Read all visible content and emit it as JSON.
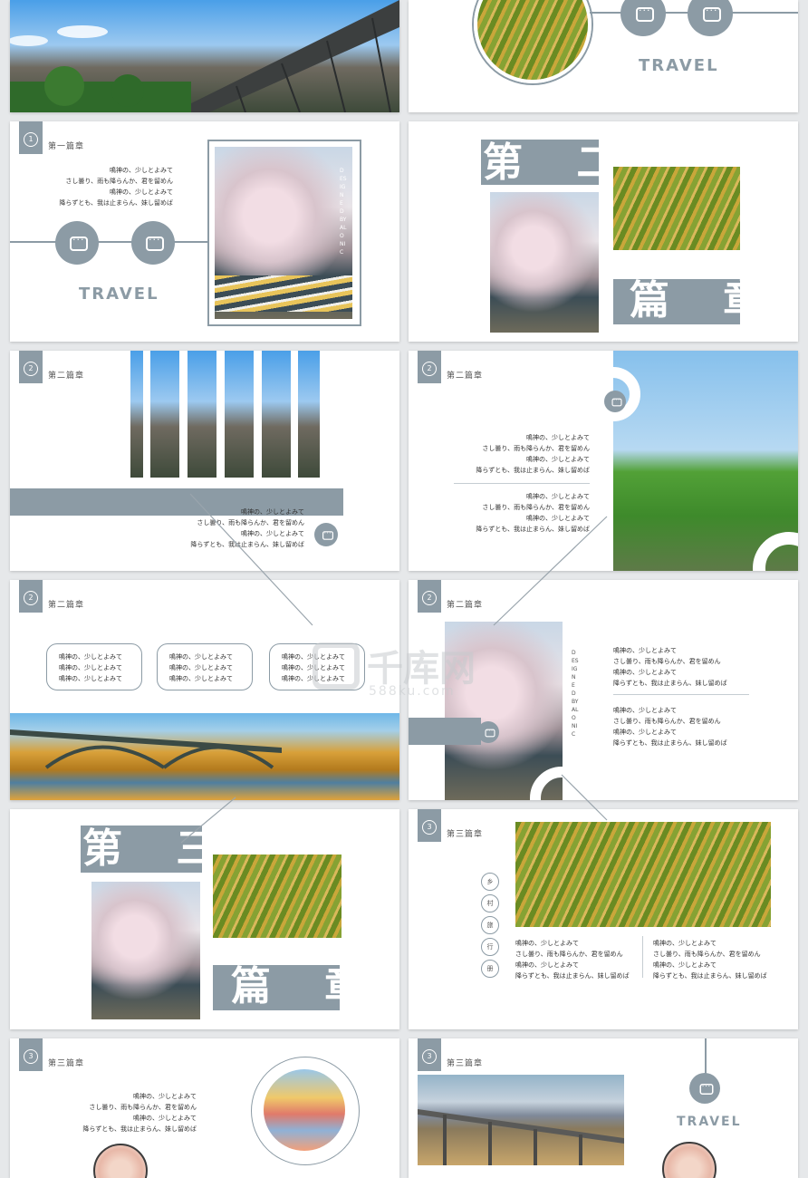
{
  "travel": "TRAVEL",
  "badges": {
    "one": "1",
    "two": "2",
    "three": "3"
  },
  "chapters": {
    "one": "第一篇章",
    "two": "第二篇章",
    "three": "第三篇章"
  },
  "big": {
    "second": "第 二",
    "third": "第 三",
    "piece": "篇 章"
  },
  "para4": "鳴神の、少しとよみて\nさし曇り、雨も降らんか、君を留めん\n鳴神の、少しとよみて\n降らずとも、我は止まらん、妹し留めば",
  "para3": "鳴神の、少しとよみて\n鳴神の、少しとよみて\n鳴神の、少しとよみて",
  "designed": "DESIGNED BY ALONIC",
  "village": [
    "乡",
    "村",
    "旅",
    "行",
    "册"
  ],
  "watermark": {
    "logo": "千库网",
    "url": "588ku.com"
  },
  "colors": {
    "accent": "#8c9ba5"
  }
}
